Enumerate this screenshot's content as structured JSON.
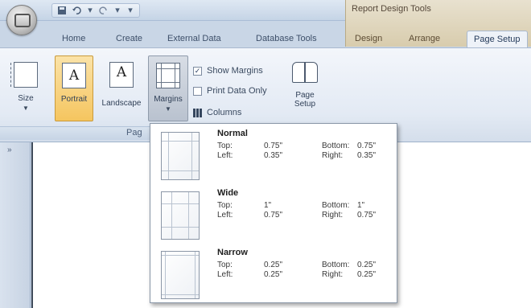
{
  "titlebar": {
    "context_title": "Report Design Tools",
    "qat_icons": [
      "save-icon",
      "undo-icon",
      "redo-icon",
      "customize-icon"
    ]
  },
  "tabs": [
    {
      "label": "Home"
    },
    {
      "label": "Create"
    },
    {
      "label": "External Data"
    },
    {
      "label": "Database Tools"
    },
    {
      "label": "Design"
    },
    {
      "label": "Arrange"
    },
    {
      "label": "Page Setup"
    }
  ],
  "ribbon": {
    "size_label": "Size",
    "portrait_label": "Portrait",
    "landscape_label": "Landscape",
    "margins_label": "Margins",
    "glyph_a": "A",
    "show_margins_label": "Show Margins",
    "show_margins_checked": true,
    "print_data_only_label": "Print Data Only",
    "print_data_only_checked": false,
    "columns_label": "Columns",
    "page_setup_label_1": "Page",
    "page_setup_label_2": "Setup",
    "group_label": "Pag"
  },
  "margins_menu": {
    "options": [
      {
        "name": "Normal",
        "top_label": "Top:",
        "top": "0.75\"",
        "bottom_label": "Bottom:",
        "bottom": "0.75\"",
        "left_label": "Left:",
        "left": "0.35\"",
        "right_label": "Right:",
        "right": "0.35\""
      },
      {
        "name": "Wide",
        "top_label": "Top:",
        "top": "1\"",
        "bottom_label": "Bottom:",
        "bottom": "1\"",
        "left_label": "Left:",
        "left": "0.75\"",
        "right_label": "Right:",
        "right": "0.75\""
      },
      {
        "name": "Narrow",
        "top_label": "Top:",
        "top": "0.25\"",
        "bottom_label": "Bottom:",
        "bottom": "0.25\"",
        "left_label": "Left:",
        "left": "0.25\"",
        "right_label": "Right:",
        "right": "0.25\""
      }
    ]
  },
  "navpane": {
    "toggle": "»"
  }
}
